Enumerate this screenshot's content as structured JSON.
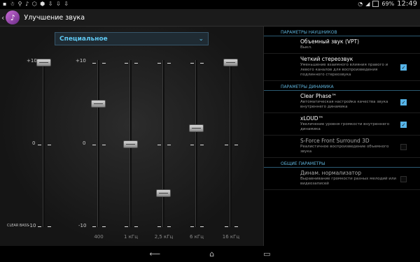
{
  "status": {
    "left_icons": "▪ ☃ ⚲ ♪ ⬡ ⬢ ⇩ ⇩ ⇩",
    "battery": "69%",
    "time": "12:49"
  },
  "app": {
    "title": "Улучшение звука",
    "back_icon": "chevron-left",
    "logo_icon": "sound-enhancement-logo"
  },
  "eq": {
    "preset": "Специальное",
    "scale_top": "+10",
    "scale_mid": "0",
    "scale_bottom": "-10",
    "clearbass_label": "CLEAR BASS",
    "bands": [
      {
        "label": "",
        "level": 10
      },
      {
        "label": "400",
        "level": 5
      },
      {
        "label": "1 кГц",
        "level": 0
      },
      {
        "label": "2,5 кГц",
        "level": -6
      },
      {
        "label": "6 кГц",
        "level": 2
      },
      {
        "label": "16 кГц",
        "level": 10
      }
    ]
  },
  "settings": {
    "headphones_section": "ПАРАМЕТРЫ НАУШНИКОВ",
    "speaker_section": "ПАРАМЕТРЫ ДИНАМИКА",
    "general_section": "ОБЩИЕ ПАРАМЕТРЫ",
    "vpt": {
      "title": "Объемный звук (VPT)",
      "sub": "Выкл."
    },
    "stereo": {
      "title": "Четкий стереозвук",
      "sub": "Уменьшение взаимного влияния правого и левого каналов для воспроизведения подлинного стереозвука",
      "checked": true
    },
    "clearphase": {
      "title": "Clear Phase™",
      "sub": "Автоматическая настройка качества звука внутреннего динамика",
      "checked": true
    },
    "xloud": {
      "title": "xLOUD™",
      "sub": "Увеличение уровня громкости внутреннего динамика",
      "checked": true
    },
    "sforce": {
      "title": "S-Force Front Surround 3D",
      "sub": "Реалистичное воспроизведение объемного звука",
      "checked": false
    },
    "normalizer": {
      "title": "Динам. нормализатор",
      "sub": "Выравнивание громкости разных мелодий или видеозаписей",
      "checked": false
    }
  },
  "nav": {
    "back": "⟵",
    "home": "⌂",
    "recent": "▭"
  }
}
